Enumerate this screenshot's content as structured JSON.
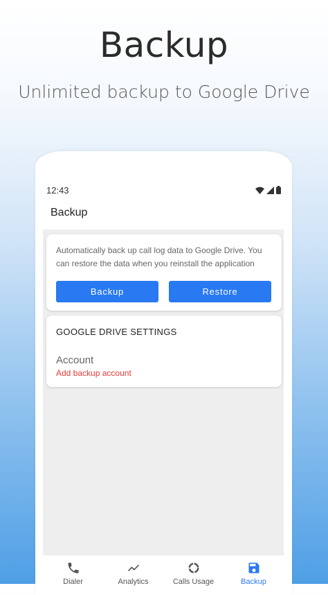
{
  "promo": {
    "title": "Backup",
    "subtitle": "Unlimited backup to Google Drive"
  },
  "status_bar": {
    "time": "12:43",
    "icons": [
      "wifi-icon",
      "signal-icon",
      "battery-icon"
    ]
  },
  "app_bar": {
    "title": "Backup"
  },
  "backup_card": {
    "description": "Automatically back up call log data to Google Drive. You can restore the data when you reinstall the application",
    "backup_label": "Backup",
    "restore_label": "Restore"
  },
  "drive_settings": {
    "header": "GOOGLE DRIVE SETTINGS",
    "account_label": "Account",
    "account_action": "Add backup account"
  },
  "bottom_nav": {
    "items": [
      {
        "label": "Dialer",
        "icon": "phone-icon"
      },
      {
        "label": "Analytics",
        "icon": "trend-icon"
      },
      {
        "label": "Calls Usage",
        "icon": "donut-icon"
      },
      {
        "label": "Backup",
        "icon": "save-icon"
      }
    ],
    "active": "Backup"
  },
  "colors": {
    "accent": "#2979f2",
    "danger": "#e53935",
    "background_gradient_bottom": "#4f9fe6"
  }
}
